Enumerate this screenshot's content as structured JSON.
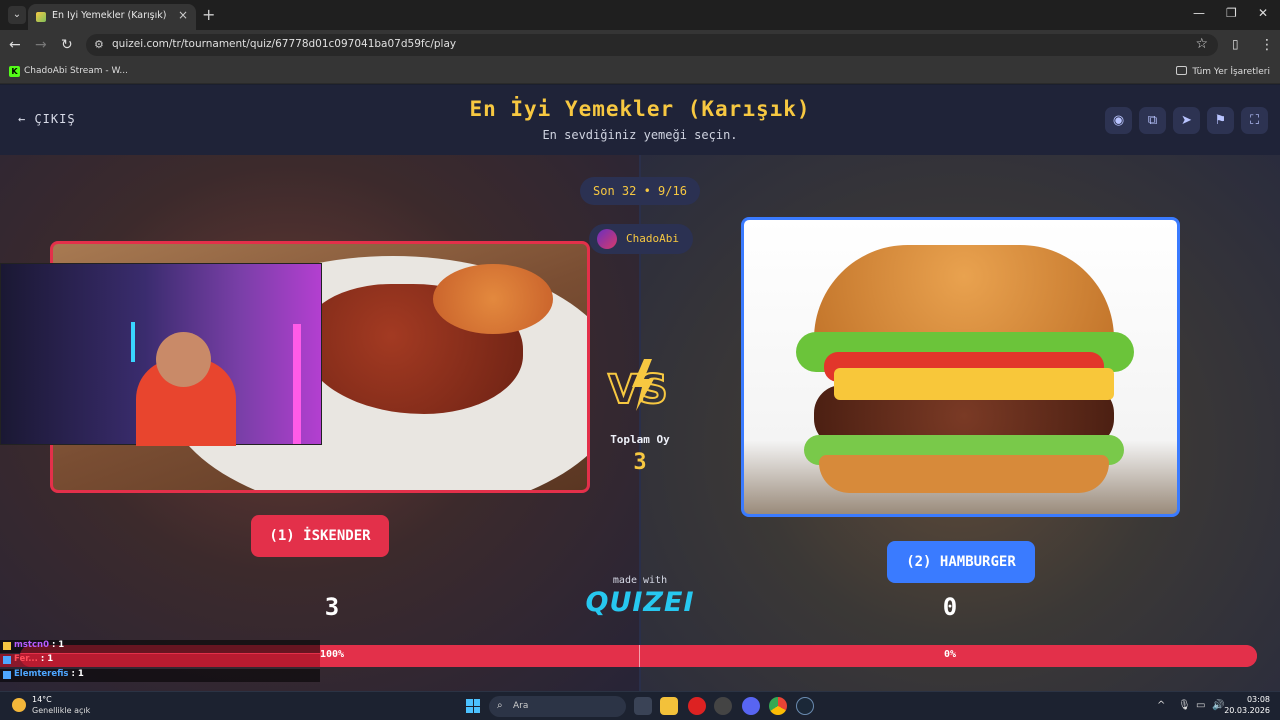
{
  "browser": {
    "tab_title": "En İyi Yemekler (Karışık) – Tier List..",
    "url": "quizei.com/tr/tournament/quiz/67778d01c097041ba07d59fc/play",
    "bookmark_label": "ChadoAbi Stream - W...",
    "bookmarks_folder": "Tüm Yer İşaretleri"
  },
  "header": {
    "exit_label": "ÇIKIŞ",
    "title": "En İyi Yemekler (Karışık)",
    "subtitle": "En sevdiğiniz yemeği seçin."
  },
  "round": {
    "label": "Son 32 • 9/16",
    "user": "ChadoAbi",
    "total_label": "Toplam Oy",
    "total_value": "3"
  },
  "left": {
    "button": "(1) İSKENDER",
    "votes": "3",
    "percent": "100%",
    "color": "#e3304a"
  },
  "right": {
    "button": "(2) HAMBURGER",
    "votes": "0",
    "percent": "0%",
    "color": "#3a7bff"
  },
  "brand": {
    "made_with": "made with",
    "logo": "QUIZEI"
  },
  "progress": {
    "left_fraction": 1.0
  },
  "chat": [
    {
      "name": "mstcn0",
      "count": ": 1",
      "color": "#b65cff"
    },
    {
      "name": "Fer...",
      "count": ": 1",
      "color": "#ff4d5a"
    },
    {
      "name": "Elemterefis",
      "count": ": 1",
      "color": "#4ea6ff"
    }
  ],
  "taskbar": {
    "temp": "14°C",
    "weather": "Genellikle açık",
    "search": "Ara",
    "time": "03:08",
    "date": "20.03.2026"
  }
}
